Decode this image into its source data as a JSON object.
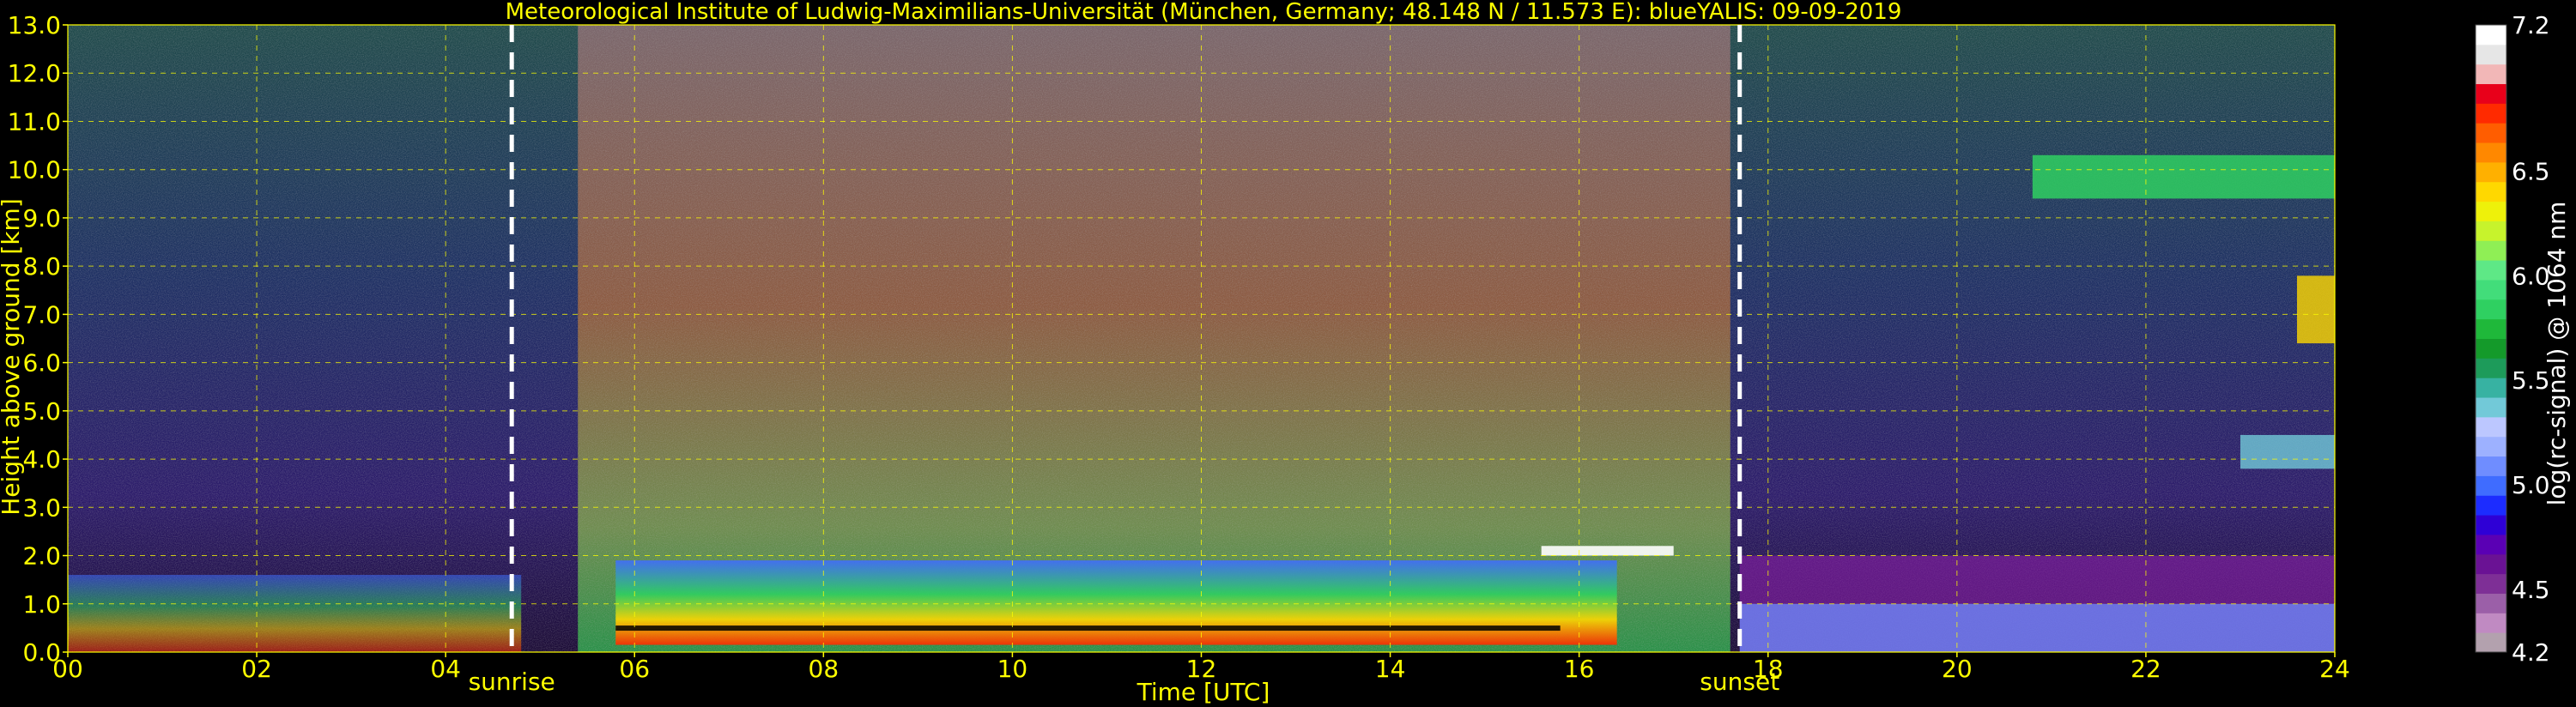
{
  "chart_data": {
    "type": "heatmap",
    "title": "Meteorological Institute of Ludwig-Maximilians-Universität (München, Germany; 48.148 N / 11.573 E):     blueYALIS: 09-09-2019",
    "xlabel": "Time [UTC]",
    "ylabel": "Height above ground [km]",
    "xlim": [
      0,
      24
    ],
    "ylim": [
      0,
      13
    ],
    "x_ticks": [
      "00",
      "02",
      "04",
      "06",
      "08",
      "10",
      "12",
      "14",
      "16",
      "18",
      "20",
      "22",
      "24"
    ],
    "y_ticks": [
      "0.0",
      "1.0",
      "2.0",
      "3.0",
      "4.0",
      "5.0",
      "6.0",
      "7.0",
      "8.0",
      "9.0",
      "10.0",
      "11.0",
      "12.0",
      "13.0"
    ],
    "grid": true,
    "markers": [
      {
        "label": "sunrise",
        "x": 4.7
      },
      {
        "label": "sunset",
        "x": 17.7
      }
    ],
    "colorbar": {
      "label": "log(rc-signal) @ 1064 nm",
      "range": [
        4.2,
        7.2
      ],
      "tick_labels": [
        "4.2",
        "4.5",
        "5.0",
        "5.5",
        "6.0",
        "6.5",
        "7.2"
      ],
      "tick_values": [
        4.2,
        4.5,
        5.0,
        5.5,
        6.0,
        6.5,
        7.2
      ],
      "colors": [
        "#b3a1ae",
        "#c08ac2",
        "#9b5fa8",
        "#7e2f96",
        "#6a1294",
        "#5a00b4",
        "#2e00d6",
        "#1c2cff",
        "#3f6cff",
        "#6f8dff",
        "#9db1ff",
        "#bcc7ff",
        "#72c9d8",
        "#37b2a2",
        "#1d9b5a",
        "#149a2a",
        "#1fb83a",
        "#2fd061",
        "#42dd7a",
        "#5ee886",
        "#8fef55",
        "#c7f32c",
        "#eef10a",
        "#ffd800",
        "#ffb000",
        "#ff8800",
        "#ff5d00",
        "#ff2a00",
        "#e8001a",
        "#f2b7b7",
        "#e6e6e6",
        "#ffffff"
      ]
    }
  }
}
